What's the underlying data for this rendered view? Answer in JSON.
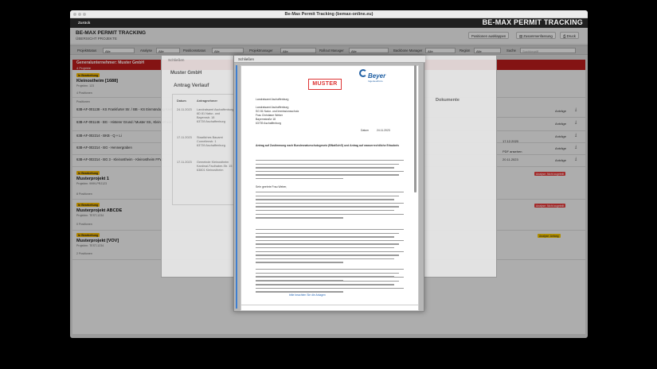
{
  "window": {
    "title": "Be-Max Permit Tracking (bemax-online.eu)",
    "back_label": "Zurück",
    "brand": "BE-MAX PERMIT TRACKING"
  },
  "app": {
    "title": "BE-MAX PERMIT TRACKING",
    "subtitle": "ÜBERSICHT PROJEKTE",
    "buttons": {
      "expand": "Positionen ausklappen",
      "summary": "Zusammenfassung",
      "print": "Druck"
    }
  },
  "filters": [
    {
      "label": "Projektstatus",
      "value": "Alle"
    },
    {
      "label": "Analyse",
      "value": "Alle"
    },
    {
      "label": "Positionsstatus",
      "value": "Alle"
    },
    {
      "label": "Projektmanager",
      "value": "Alle"
    },
    {
      "label": "Rollout Manager",
      "value": "Alle"
    },
    {
      "label": "Backbone Manager",
      "value": "Alle"
    },
    {
      "label": "Region",
      "value": "Alle"
    },
    {
      "label": "Suche",
      "value": "",
      "placeholder": "Suchbegriff"
    }
  ],
  "group": {
    "name": "Generalunternehmer: Muster GmbH",
    "count": "4 Projekte"
  },
  "projects": [
    {
      "badge": "In Bearbeitung",
      "name": "Kleinostheim [1688]",
      "sub": "Projektnr. 123",
      "positions_label": "4 Positionen",
      "positions_header": "Positionen",
      "rows": [
        "63B-AF-001138 - KS Frankfurter Str. / BB - KS Einmündung Kastanienweg, Kleinostheim",
        "63B-AF-001146 - BG - Hinterer Grund / Muster Str., Kleinostheim Flurst.",
        "63B-AF-002214 - BKB - Q + Li",
        "63B-AF-002214 - BG - Hennergraben",
        "63B-AF-002214 - BG 3 - Kleinostheim - Kleinostheim FFW"
      ]
    },
    {
      "badge": "In Bearbeitung",
      "name": "Musterprojekt 1",
      "sub": "Projektnr. 9999-PRJ123",
      "positions_label": "8 Positionen"
    },
    {
      "badge": "In Bearbeitung",
      "name": "Musterprojekt ABCDE",
      "sub": "Projektnr. TEST-1234",
      "positions_label": "0 Positionen"
    },
    {
      "badge": "In Bearbeitung",
      "name": "Musterprojekt [VOV]",
      "sub": "Projektnr. TEST-1234",
      "positions_label": "2 Positionen"
    }
  ],
  "row_action": "Anträge",
  "right_tags": {
    "dates": [
      "17.12.2020",
      "PDF ansehen",
      "20.11.2023"
    ],
    "red1": "Analyse: Nicht zugeteilt",
    "red2": "Analyse: Nicht zugeteilt",
    "yellow": "Analyse: Anfang"
  },
  "dialog2": {
    "title": "Schließen",
    "company": "Muster GmbH",
    "section": "Antrag Verlauf",
    "docs_title": "Dokumente",
    "col_date": "Datum",
    "col_applicant": "Antragnehmer",
    "entries": [
      {
        "date": "24.11.2023",
        "text": "Landratsamt Aschaffenburg\n6D 81 Natur- und\nBayernstr. 18\n63739 Aschaffenburg"
      },
      {
        "date": "17.11.2023",
        "text": "Staatliches Bauamt\nCornelienstr. 1\n63739 Aschaffenburg"
      },
      {
        "date": "17.11.2023",
        "text": "Gemeinde Kleinostheim\nKardinal-Faulhaber-Str. 15\n63801 Kleinostheim"
      }
    ]
  },
  "doc": {
    "title": "Schließen",
    "stamp": "MUSTER",
    "logo_name": "Beyer",
    "logo_tag": "Ingenieurbüro",
    "sender": "Landratsamt Aschaffenburg",
    "address": [
      "Landratsamt Aschaffenburg",
      "SG 81 Natur- und Immissionsschutz",
      "Frau Christiane Weber",
      "Bayernstraße 18",
      "63739 Aschaffenburg"
    ],
    "dated_label": "Datum",
    "dated": "24.11.2023",
    "greeting": "Sehr geehrte Frau Weber,",
    "subject": "Antrag auf Zustimmung nach Bundesnaturschutzgesetz (BNatSchG) und Antrag auf wasserrechtliche Erlaubnis",
    "footer_note": "bitte beachten Sie die Anlagen"
  }
}
